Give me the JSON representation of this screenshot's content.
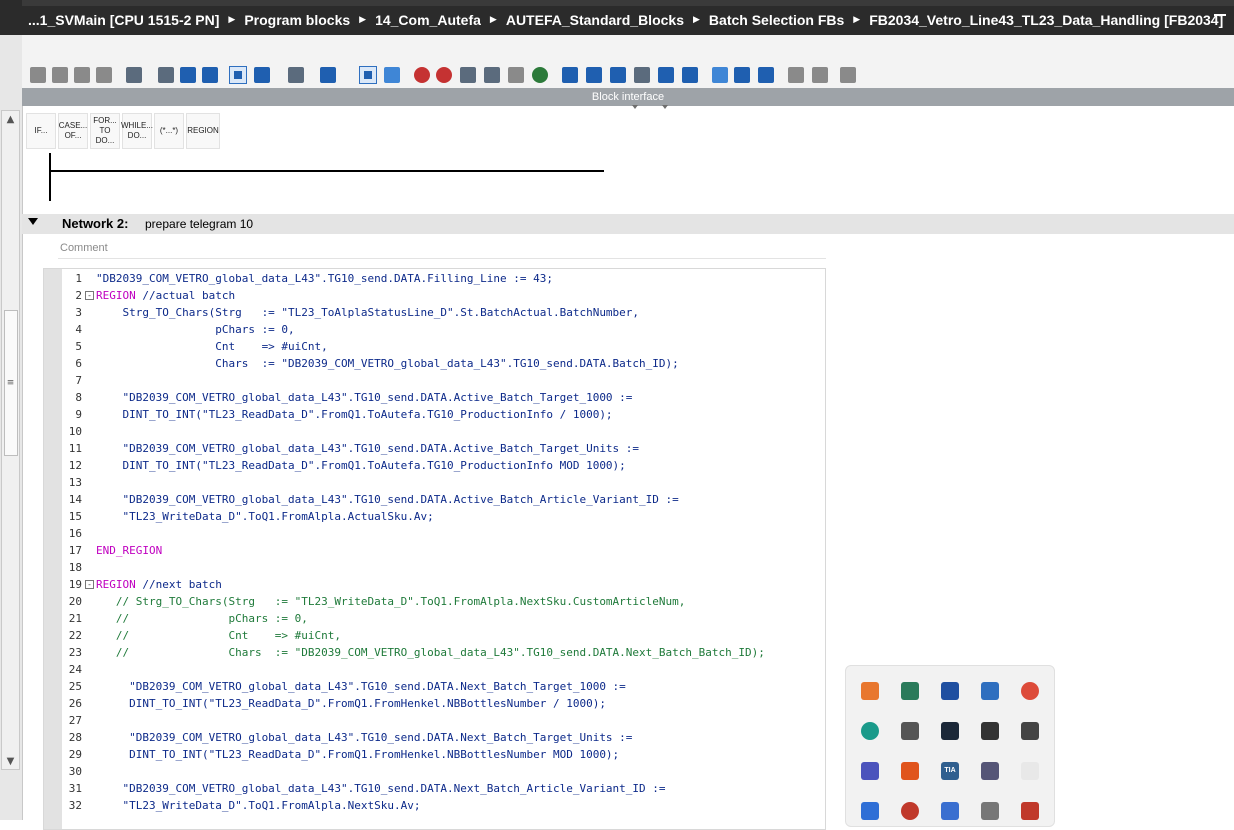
{
  "title_bar": {
    "breadcrumb": [
      "...1_SVMain [CPU 1515-2 PN]",
      "Program blocks",
      "14_Com_Autefa",
      "AUTEFA_Standard_Blocks",
      "Batch Selection FBs",
      "FB2034_Vetro_Line43_TL23_Data_Handling [FB2034]"
    ],
    "separator": "▶"
  },
  "block_interface": {
    "label": "Block interface"
  },
  "palette": {
    "items": [
      "IF...",
      "CASE... OF...",
      "FOR... TO DO...",
      "WHILE... DO...",
      "(*...*)",
      "REGION"
    ]
  },
  "network2": {
    "title": "Network 2:",
    "description": "prepare telegram 10",
    "comment_placeholder": "Comment"
  },
  "code": {
    "lines": [
      {
        "n": "1",
        "t": "\"DB2039_COM_VETRO_global_data_L43\".TG10_send.DATA.Filling_Line := 43;",
        "k": "str"
      },
      {
        "n": "2",
        "t": "REGION //actual batch",
        "k": "region",
        "fold": "-"
      },
      {
        "n": "3",
        "t": "    Strg_TO_Chars(Strg   := \"TL23_ToAlplaStatusLine_D\".St.BatchActual.BatchNumber,",
        "k": "str"
      },
      {
        "n": "4",
        "t": "                  pChars := 0,",
        "k": "str"
      },
      {
        "n": "5",
        "t": "                  Cnt    => #uiCnt,",
        "k": "str"
      },
      {
        "n": "6",
        "t": "                  Chars  := \"DB2039_COM_VETRO_global_data_L43\".TG10_send.DATA.Batch_ID);",
        "k": "str"
      },
      {
        "n": "7",
        "t": "",
        "k": "str"
      },
      {
        "n": "8",
        "t": "    \"DB2039_COM_VETRO_global_data_L43\".TG10_send.DATA.Active_Batch_Target_1000 :=",
        "k": "str"
      },
      {
        "n": "9",
        "t": "    DINT_TO_INT(\"TL23_ReadData_D\".FromQ1.ToAutefa.TG10_ProductionInfo / 1000);",
        "k": "str"
      },
      {
        "n": "10",
        "t": "",
        "k": "str"
      },
      {
        "n": "11",
        "t": "    \"DB2039_COM_VETRO_global_data_L43\".TG10_send.DATA.Active_Batch_Target_Units :=",
        "k": "str"
      },
      {
        "n": "12",
        "t": "    DINT_TO_INT(\"TL23_ReadData_D\".FromQ1.ToAutefa.TG10_ProductionInfo MOD 1000);",
        "k": "str"
      },
      {
        "n": "13",
        "t": "",
        "k": "str"
      },
      {
        "n": "14",
        "t": "    \"DB2039_COM_VETRO_global_data_L43\".TG10_send.DATA.Active_Batch_Article_Variant_ID :=",
        "k": "str"
      },
      {
        "n": "15",
        "t": "    \"TL23_WriteData_D\".ToQ1.FromAlpla.ActualSku.Av;",
        "k": "str"
      },
      {
        "n": "16",
        "t": "",
        "k": "str"
      },
      {
        "n": "17",
        "t": "END_REGION",
        "k": "region"
      },
      {
        "n": "18",
        "t": "",
        "k": "str"
      },
      {
        "n": "19",
        "t": "REGION //next batch",
        "k": "region",
        "fold": "-"
      },
      {
        "n": "20",
        "t": "   // Strg_TO_Chars(Strg   := \"TL23_WriteData_D\".ToQ1.FromAlpla.NextSku.CustomArticleNum,",
        "k": "cmt"
      },
      {
        "n": "21",
        "t": "   //               pChars := 0,",
        "k": "cmt"
      },
      {
        "n": "22",
        "t": "   //               Cnt    => #uiCnt,",
        "k": "cmt"
      },
      {
        "n": "23",
        "t": "   //               Chars  := \"DB2039_COM_VETRO_global_data_L43\".TG10_send.DATA.Next_Batch_Batch_ID);",
        "k": "cmt"
      },
      {
        "n": "24",
        "t": "",
        "k": "str"
      },
      {
        "n": "25",
        "t": "     \"DB2039_COM_VETRO_global_data_L43\".TG10_send.DATA.Next_Batch_Target_1000 :=",
        "k": "str"
      },
      {
        "n": "26",
        "t": "     DINT_TO_INT(\"TL23_ReadData_D\".FromQ1.FromHenkel.NBBottlesNumber / 1000);",
        "k": "str"
      },
      {
        "n": "27",
        "t": "",
        "k": "str"
      },
      {
        "n": "28",
        "t": "     \"DB2039_COM_VETRO_global_data_L43\".TG10_send.DATA.Next_Batch_Target_Units :=",
        "k": "str"
      },
      {
        "n": "29",
        "t": "     DINT_TO_INT(\"TL23_ReadData_D\".FromQ1.FromHenkel.NBBottlesNumber MOD 1000);",
        "k": "str"
      },
      {
        "n": "30",
        "t": "",
        "k": "str"
      },
      {
        "n": "31",
        "t": "    \"DB2039_COM_VETRO_global_data_L43\".TG10_send.DATA.Next_Batch_Article_Variant_ID :=",
        "k": "str"
      },
      {
        "n": "32",
        "t": "    \"TL23_WriteData_D\".ToQ1.FromAlpla.NextSku.Av;",
        "k": "str"
      }
    ]
  },
  "tray": {
    "icons": [
      "bandicam-icon",
      "network-icon",
      "info-icon",
      "vpn-icon",
      "chrome-icon",
      "target-icon",
      "grid-icon",
      "steam-icon",
      "vector-icon",
      "mail-icon",
      "teams-icon",
      "office-icon",
      "tia-portal-icon",
      "user-icon",
      "blank-icon",
      "dj-icon",
      "error-icon",
      "link-icon",
      "server-icon",
      "box-icon"
    ],
    "tia_label": "TIA"
  }
}
